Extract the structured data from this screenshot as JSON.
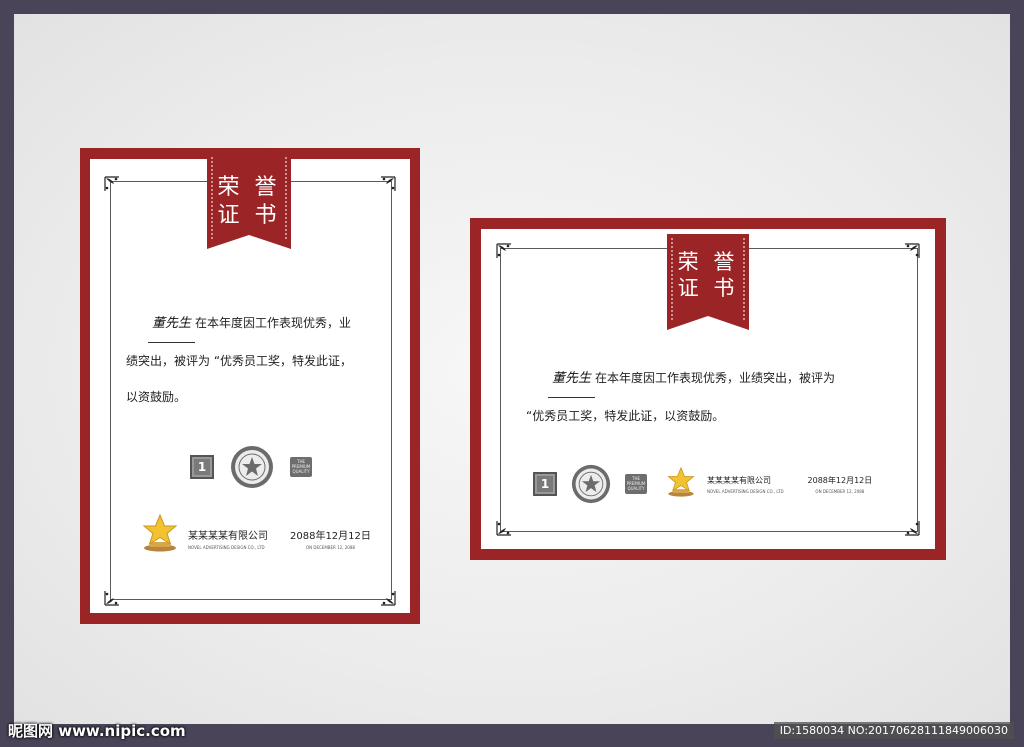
{
  "colors": {
    "accent": "#9b2426",
    "paper": "#ffffff",
    "background": "#4a4458"
  },
  "certificate": {
    "ribbon_line1": "荣 誉",
    "ribbon_line2": "证 书",
    "recipient": "董先生",
    "body_portrait_1": "在本年度因工作表现优秀，业",
    "body_portrait_2": "绩突出，被评为 “优秀员工奖，特发此证，",
    "body_portrait_3": "以资鼓励。",
    "body_landscape_1": "在本年度因工作表现优秀，业绩突出，被评为",
    "body_landscape_2": "“优秀员工奖，特发此证，以资鼓励。",
    "badge_number": "1",
    "quality_badge": [
      "THE",
      "PREMIUM",
      "QUALITY"
    ],
    "company_cn": "某某某某有限公司",
    "company_en": "NOVEL ADVERTISING DESIGN CO., LTD",
    "date_cn": "2088年12月12日",
    "date_en": "ON DECEMBER 12, 2088"
  },
  "watermark": {
    "left": "昵图网 www.nipic.com",
    "right": "ID:1580034 NO:20170628111849006030"
  },
  "icons": [
    "corner-ornament-icon",
    "ribbon-banner-icon",
    "number-one-badge-icon",
    "star-seal-icon",
    "quality-badge-icon",
    "gold-star-trophy-icon"
  ]
}
